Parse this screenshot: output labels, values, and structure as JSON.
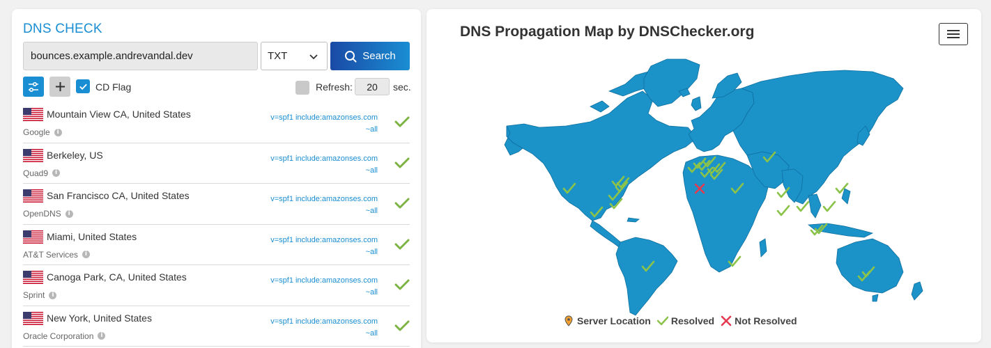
{
  "app": {
    "title": "DNS CHECK",
    "domain_value": "bounces.example.andrevandal.dev",
    "record_type": "TXT",
    "search_label": "Search",
    "cd_flag_label": "CD Flag",
    "cd_flag_checked": true,
    "refresh_label": "Refresh:",
    "refresh_value": "20",
    "refresh_unit": "sec.",
    "refresh_checked": false
  },
  "servers": [
    {
      "location": "Mountain View CA, United States",
      "provider": "Google",
      "record_line1": "v=spf1 include:amazonses.com",
      "record_line2": "~all",
      "status": "resolved"
    },
    {
      "location": "Berkeley, US",
      "provider": "Quad9",
      "record_line1": "v=spf1 include:amazonses.com",
      "record_line2": "~all",
      "status": "resolved"
    },
    {
      "location": "San Francisco CA, United States",
      "provider": "OpenDNS",
      "record_line1": "v=spf1 include:amazonses.com",
      "record_line2": "~all",
      "status": "resolved"
    },
    {
      "location": "Miami, United States",
      "provider": "AT&T Services",
      "record_line1": "v=spf1 include:amazonses.com",
      "record_line2": "~all",
      "status": "resolved"
    },
    {
      "location": "Canoga Park, CA, United States",
      "provider": "Sprint",
      "record_line1": "v=spf1 include:amazonses.com",
      "record_line2": "~all",
      "status": "resolved"
    },
    {
      "location": "New York, United States",
      "provider": "Oracle Corporation",
      "record_line1": "v=spf1 include:amazonses.com",
      "record_line2": "~all",
      "status": "resolved"
    }
  ],
  "map": {
    "title": "DNS Propagation Map by DNSChecker.org",
    "land_color": "#1b93c9",
    "border_color": "#0f6f9f",
    "resolved_color": "#8bc34a",
    "not_resolved_color": "#e53950",
    "legend": {
      "server_location": "Server Location",
      "resolved": "Resolved",
      "not_resolved": "Not Resolved"
    }
  },
  "colors": {
    "accent": "#1a8ed2",
    "button_dark": "#1a4aa6",
    "resolved_check": "#7cb342"
  }
}
